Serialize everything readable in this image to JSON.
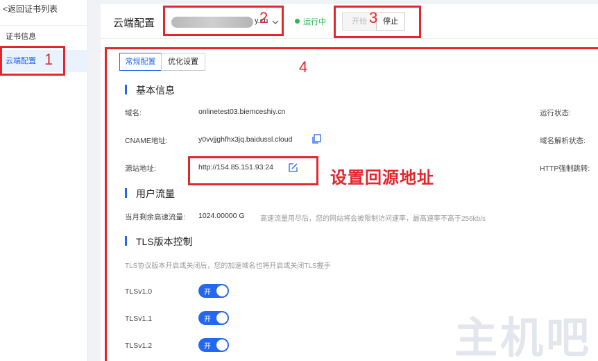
{
  "sidebar": {
    "back_link": "<返回证书列表",
    "items": [
      {
        "label": "证书信息"
      },
      {
        "label": "云端配置"
      }
    ]
  },
  "header": {
    "title": "云端配置",
    "domain_suffix": "y.cn",
    "status": "运行中",
    "start_label": "开始",
    "stop_label": "停止"
  },
  "tabs": [
    {
      "label": "常规配置"
    },
    {
      "label": "优化设置"
    }
  ],
  "basic_info": {
    "title": "基本信息",
    "domain_label": "域名:",
    "domain_value": "onlinetest03.biemceshiy.cn",
    "run_status_label": "运行状态:",
    "cname_label": "CNAME地址:",
    "cname_value": "y0vvjjghfhx3jq.baidussl.cloud",
    "dns_status_label": "域名解析状态:",
    "origin_label": "源站地址:",
    "origin_value": "http://154.85.151.93:24",
    "https_label": "HTTP强制跳转:"
  },
  "traffic": {
    "title": "用户流量",
    "remaining_label": "当月剩余高速流量:",
    "remaining_value": "1024.00000 G",
    "hint": "高速流量用尽后，您的网站将会被限制访问速率，最高速率不高于256kb/s"
  },
  "tls": {
    "title": "TLS版本控制",
    "hint": "TLS协议版本开启或关闭后，您的加速域名也将开启或关闭TLS握手",
    "versions": [
      {
        "name": "TLSv1.0",
        "state": "开"
      },
      {
        "name": "TLSv1.1",
        "state": "开"
      },
      {
        "name": "TLSv1.2",
        "state": "开"
      }
    ]
  },
  "annotations": {
    "n1": "1",
    "n2": "2",
    "n3": "3",
    "n4": "4",
    "caption": "设置回源地址",
    "color": "#e0272c"
  },
  "watermark": "主机吧",
  "colors": {
    "accent": "#2468f2",
    "running": "#2cb553"
  }
}
